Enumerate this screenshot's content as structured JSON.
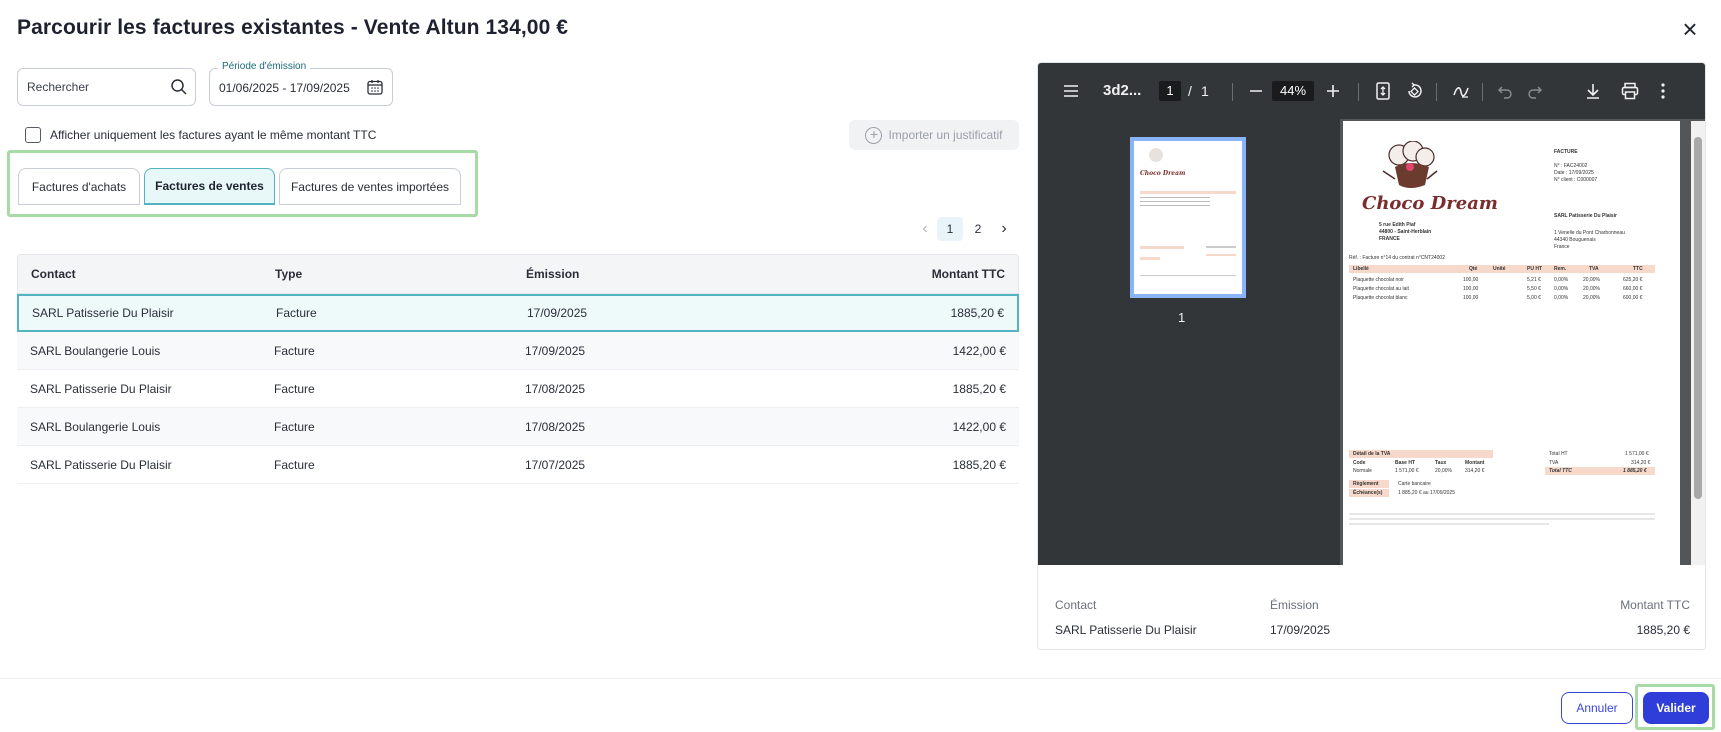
{
  "dialog": {
    "title": "Parcourir les factures existantes - Vente Altun 134,00 €",
    "close_label": "×"
  },
  "search": {
    "placeholder": "Rechercher"
  },
  "period": {
    "legend": "Période d'émission",
    "value": "01/06/2025 - 17/09/2025"
  },
  "filter": {
    "same_amount_label": "Afficher uniquement les factures ayant le même montant TTC",
    "checked": false
  },
  "import_button": {
    "label": "Importer un justificatif"
  },
  "tabs": [
    {
      "label": "Factures d'achats",
      "active": false
    },
    {
      "label": "Factures de ventes",
      "active": true
    },
    {
      "label": "Factures de ventes importées",
      "active": false
    }
  ],
  "pagination": {
    "prev": "‹",
    "pages": [
      "1",
      "2"
    ],
    "current": "1",
    "next": "›"
  },
  "table": {
    "headers": {
      "contact": "Contact",
      "type": "Type",
      "emission": "Émission",
      "amount": "Montant TTC"
    },
    "rows": [
      {
        "contact": "SARL Patisserie Du Plaisir",
        "type": "Facture",
        "emission": "17/09/2025",
        "amount": "1885,20 €",
        "selected": true
      },
      {
        "contact": "SARL Boulangerie Louis",
        "type": "Facture",
        "emission": "17/09/2025",
        "amount": "1422,00 €",
        "selected": false
      },
      {
        "contact": "SARL Patisserie Du Plaisir",
        "type": "Facture",
        "emission": "17/08/2025",
        "amount": "1885,20 €",
        "selected": false
      },
      {
        "contact": "SARL Boulangerie Louis",
        "type": "Facture",
        "emission": "17/08/2025",
        "amount": "1422,00 €",
        "selected": false
      },
      {
        "contact": "SARL Patisserie Du Plaisir",
        "type": "Facture",
        "emission": "17/07/2025",
        "amount": "1885,20 €",
        "selected": false
      }
    ]
  },
  "pdf_viewer": {
    "file_name": "3d2...",
    "page_current": "1",
    "page_sep": "/",
    "page_total": "1",
    "zoom": "44%",
    "thumbnail_label": "1",
    "page": {
      "brand": "Choco Dream",
      "heading": "FACTURE",
      "meta": [
        "N° : FAC24002",
        "Date : 17/09/2025",
        "N° client : C000007"
      ],
      "seller": [
        "5 rue Edith Piaf",
        "44800 - Saint-Herblain",
        "FRANCE"
      ],
      "buyer": [
        "SARL Patisserie Du Plaisir",
        "1 Venelle du Pont Charbonneau",
        "44340 Bouguenais",
        "France"
      ],
      "ref": "Réf. : Facture n°14 du contrat n°CNT24002",
      "columns": [
        "Libellé",
        "Qté",
        "Unité",
        "PU HT",
        "Rem.",
        "TVA",
        "TTC"
      ],
      "lines": [
        [
          "Plaquette chocolat noir",
          "100,00",
          "",
          "5,21 €",
          "0,00%",
          "20,00%",
          "625,20 €"
        ],
        [
          "Plaquette chocolat au lait",
          "100,00",
          "",
          "5,50 €",
          "0,00%",
          "20,00%",
          "660,00 €"
        ],
        [
          "Plaquette chocolat blanc",
          "100,00",
          "",
          "5,00 €",
          "0,00%",
          "20,00%",
          "600,00 €"
        ]
      ],
      "vat_title": "Détail de la TVA",
      "vat_headers": [
        "Code",
        "Base HT",
        "Taux",
        "Montant"
      ],
      "vat_row": [
        "Normale",
        "1 571,00 €",
        "20,00%",
        "314,20 €"
      ],
      "totals": [
        [
          "Total HT",
          "1 571,00 €"
        ],
        [
          "TVA",
          "314,20 €"
        ],
        [
          "Total TTC",
          "1 885,20 €"
        ]
      ],
      "payment": [
        [
          "Règlement",
          "Carte bancaire"
        ],
        [
          "Échéance(s)",
          "1 885,20 € au 17/09/2025"
        ]
      ]
    }
  },
  "summary": {
    "contact_label": "Contact",
    "contact_value": "SARL Patisserie Du Plaisir",
    "emission_label": "Émission",
    "emission_value": "17/09/2025",
    "amount_label": "Montant TTC",
    "amount_value": "1885,20 €"
  },
  "footer": {
    "cancel_label": "Annuler",
    "validate_label": "Valider"
  },
  "colors": {
    "accent": "#2f3ed8",
    "teal": "#52b4c0",
    "highlight": "#a6dba6"
  }
}
